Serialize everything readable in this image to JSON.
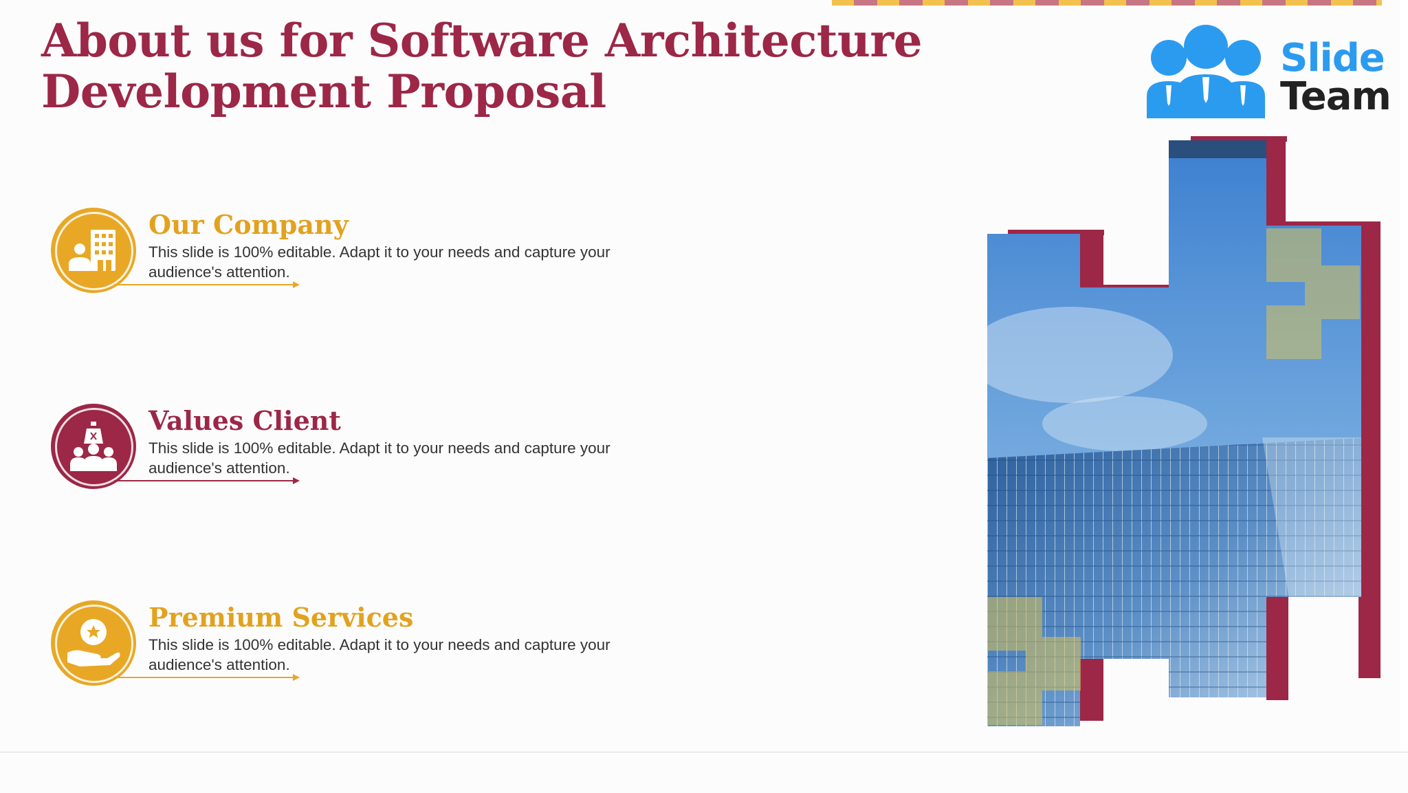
{
  "slide": {
    "title": "About us for Software Architecture Development Proposal"
  },
  "logo": {
    "word1": "Slide",
    "word2": "Team"
  },
  "items": [
    {
      "heading": "Our Company",
      "description": "This slide is 100% editable. Adapt it to your needs and capture your audience's attention.",
      "icon": "building-person-icon",
      "color": "#e8a825"
    },
    {
      "heading": "Values Client",
      "description": "This slide is 100% editable. Adapt it to your needs and capture your audience's attention.",
      "icon": "group-with-bag-icon",
      "color": "#9c2747"
    },
    {
      "heading": "Premium Services",
      "description": "This slide is 100% editable. Adapt it to your needs and capture your audience's attention.",
      "icon": "hand-with-star-badge-icon",
      "color": "#e8a825"
    }
  ],
  "colors": {
    "maroon": "#9c2747",
    "gold": "#e8a825",
    "logo_blue": "#2b9bf0"
  }
}
